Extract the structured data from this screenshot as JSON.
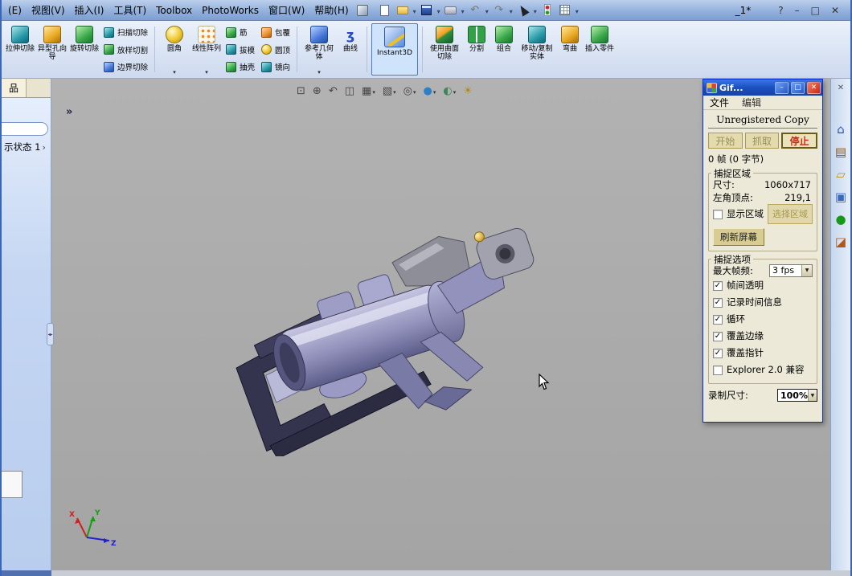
{
  "menubar": {
    "items": [
      "(E)",
      "视图(V)",
      "插入(I)",
      "工具(T)",
      "Toolbox",
      "PhotoWorks",
      "窗口(W)",
      "帮助(H)"
    ],
    "doc_title": "_1*",
    "help": "?",
    "minimize": "–",
    "restore": "□",
    "close": "✕"
  },
  "feature_toolbar": {
    "buttons": [
      "拉伸切除",
      "异型孔向导",
      "旋转切除",
      "扫描切除",
      "放样切割",
      "边界切除",
      "圆角",
      "线性阵列",
      "筋",
      "拔模",
      "抽壳",
      "包覆",
      "圆顶",
      "镜向",
      "参考几何体",
      "曲线",
      "Instant3D",
      "使用曲面切除",
      "分割",
      "组合",
      "移动/复制实体",
      "弯曲",
      "插入零件"
    ]
  },
  "left_panel": {
    "tab": "品",
    "expand": "»",
    "display_state": "示状态 1"
  },
  "icons": {
    "curve_glyph": "ʒ",
    "zoom_fit": "⊡",
    "zoom_area": "⊕",
    "previous_view": "↶",
    "section_view": "◫",
    "view_orientation": "▦",
    "display_style": "▧",
    "hide_show": "◎",
    "appearance": "●",
    "scene": "◐",
    "lights": "☀",
    "taskpane_close": "✕",
    "home": "⌂",
    "design_library": "▤",
    "file_explorer": "▱",
    "view_palette": "▣",
    "photoworks_ball": "●",
    "appearance_palette": "◪"
  },
  "triad": {
    "x": "X",
    "y": "Y",
    "z": "Z"
  },
  "gif_window": {
    "title": "Gif...",
    "buttons": {
      "minimize": "–",
      "maximize": "□",
      "close": "✕"
    },
    "menu": [
      "文件",
      "编辑"
    ],
    "unregistered": "Unregistered Copy",
    "controls": {
      "start": "开始",
      "grab": "抓取",
      "stop": "停止"
    },
    "frame_status": "0 帧 (0 字节)",
    "capture_area": {
      "title": "捕捉区域",
      "size_label": "尺寸:",
      "size_value": "1060x717",
      "corner_label": "左角顶点:",
      "corner_value": "219,1",
      "show_area_label": "显示区域",
      "show_area_mark": "",
      "select_area_button": "选择区域",
      "refresh_button": "刷新屏幕"
    },
    "capture_options": {
      "title": "捕捉选项",
      "fps_label": "最大帧频:",
      "fps_value": "3 fps",
      "checkboxes": [
        {
          "label": "帧间透明",
          "mark": "✓"
        },
        {
          "label": "记录时间信息",
          "mark": "✓"
        },
        {
          "label": "循环",
          "mark": "✓"
        },
        {
          "label": "覆盖边缘",
          "mark": "✓"
        },
        {
          "label": "覆盖指针",
          "mark": "✓"
        },
        {
          "label": "Explorer 2.0 兼容",
          "mark": ""
        }
      ],
      "record_size_label": "录制尺寸:",
      "record_size_value": "100%"
    }
  }
}
